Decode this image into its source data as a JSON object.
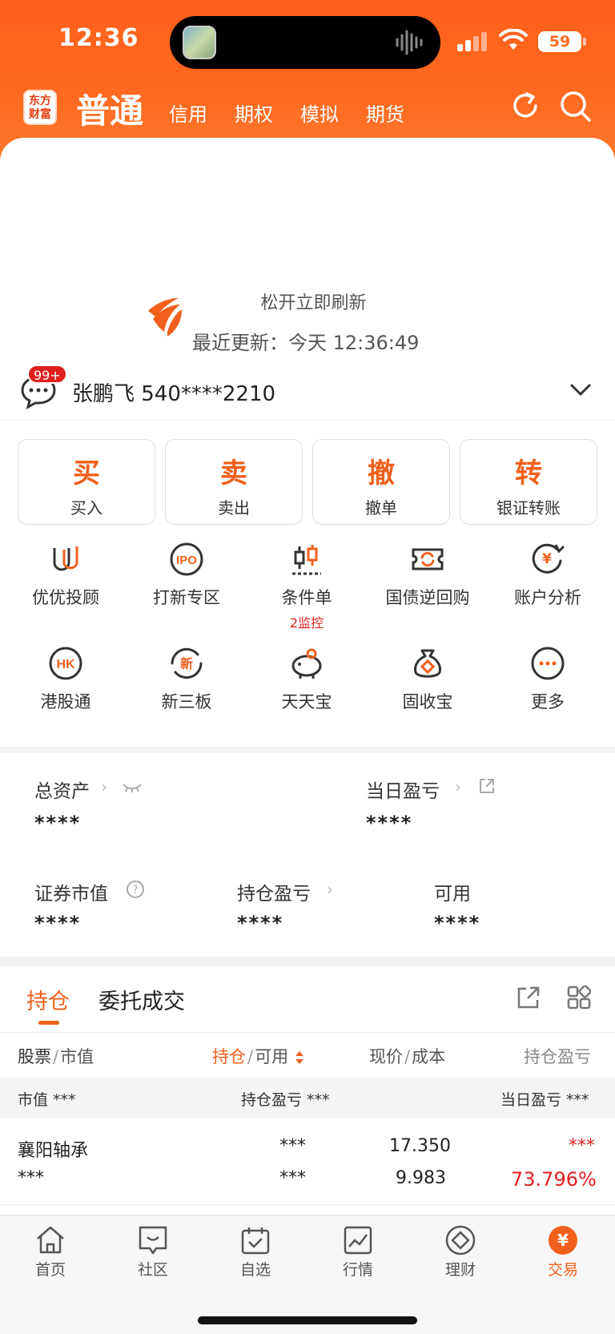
{
  "status_bar": {
    "time": "12:36",
    "battery": "59"
  },
  "header": {
    "logo_text": "东方财富",
    "tabs": [
      {
        "label": "普通",
        "active": true
      },
      {
        "label": "信用"
      },
      {
        "label": "期权"
      },
      {
        "label": "模拟"
      },
      {
        "label": "期货"
      }
    ],
    "icons": [
      "refresh-icon",
      "search-icon"
    ]
  },
  "refresh": {
    "title": "松开立即刷新",
    "last_update": "最近更新：今天 12:36:49"
  },
  "account": {
    "badge": "99+",
    "name": "张鹏飞  540****2210"
  },
  "trade_buttons": [
    {
      "big": "买",
      "small": "买入"
    },
    {
      "big": "卖",
      "small": "卖出"
    },
    {
      "big": "撤",
      "small": "撤单"
    },
    {
      "big": "转",
      "small": "银证转账"
    }
  ],
  "grid": [
    {
      "label": "优优投顾",
      "icon": "youyou-icon"
    },
    {
      "label": "打新专区",
      "icon": "ipo-icon"
    },
    {
      "label": "条件单",
      "sub": "2监控",
      "icon": "condition-order-icon"
    },
    {
      "label": "国债逆回购",
      "icon": "repo-icon"
    },
    {
      "label": "账户分析",
      "icon": "account-analysis-icon"
    },
    {
      "label": "港股通",
      "icon": "hk-icon"
    },
    {
      "label": "新三板",
      "icon": "new-board-icon"
    },
    {
      "label": "天天宝",
      "icon": "piggy-bank-icon"
    },
    {
      "label": "固收宝",
      "icon": "money-bag-icon"
    },
    {
      "label": "更多",
      "icon": "more-icon"
    }
  ],
  "assets": {
    "total_label": "总资产",
    "total_value": "****",
    "daily_label": "当日盈亏",
    "daily_value": "****",
    "securities_label": "证券市值",
    "securities_value": "****",
    "position_pl_label": "持仓盈亏",
    "position_pl_value": "****",
    "available_label": "可用",
    "available_value": "****"
  },
  "holdings": {
    "tabs": [
      "持仓",
      "委托成交"
    ],
    "columns": {
      "c1a": "股票",
      "c1b": "市值",
      "c2a": "持仓",
      "c2b": "可用",
      "c3a": "现价",
      "c3b": "成本",
      "c4": "持仓盈亏"
    },
    "summary": {
      "market_value": "市值 ***",
      "position_pl": "持仓盈亏 ***",
      "daily_pl": "当日盈亏 ***"
    },
    "rows": [
      {
        "name": "襄阳轴承",
        "market_value": "***",
        "position": "***",
        "available": "***",
        "price": "17.350",
        "cost": "9.983",
        "pl": "***",
        "pl_pct": "73.796%"
      }
    ]
  },
  "bottom_nav": [
    {
      "label": "首页",
      "icon": "home-icon"
    },
    {
      "label": "社区",
      "icon": "community-icon"
    },
    {
      "label": "自选",
      "icon": "watchlist-icon"
    },
    {
      "label": "行情",
      "icon": "market-icon"
    },
    {
      "label": "理财",
      "icon": "wealth-icon"
    },
    {
      "label": "交易",
      "icon": "trade-icon",
      "active": true
    }
  ],
  "colors": {
    "brand": "#f0601c",
    "header": "#ff6420",
    "loss_gain_red": "#e02020"
  }
}
